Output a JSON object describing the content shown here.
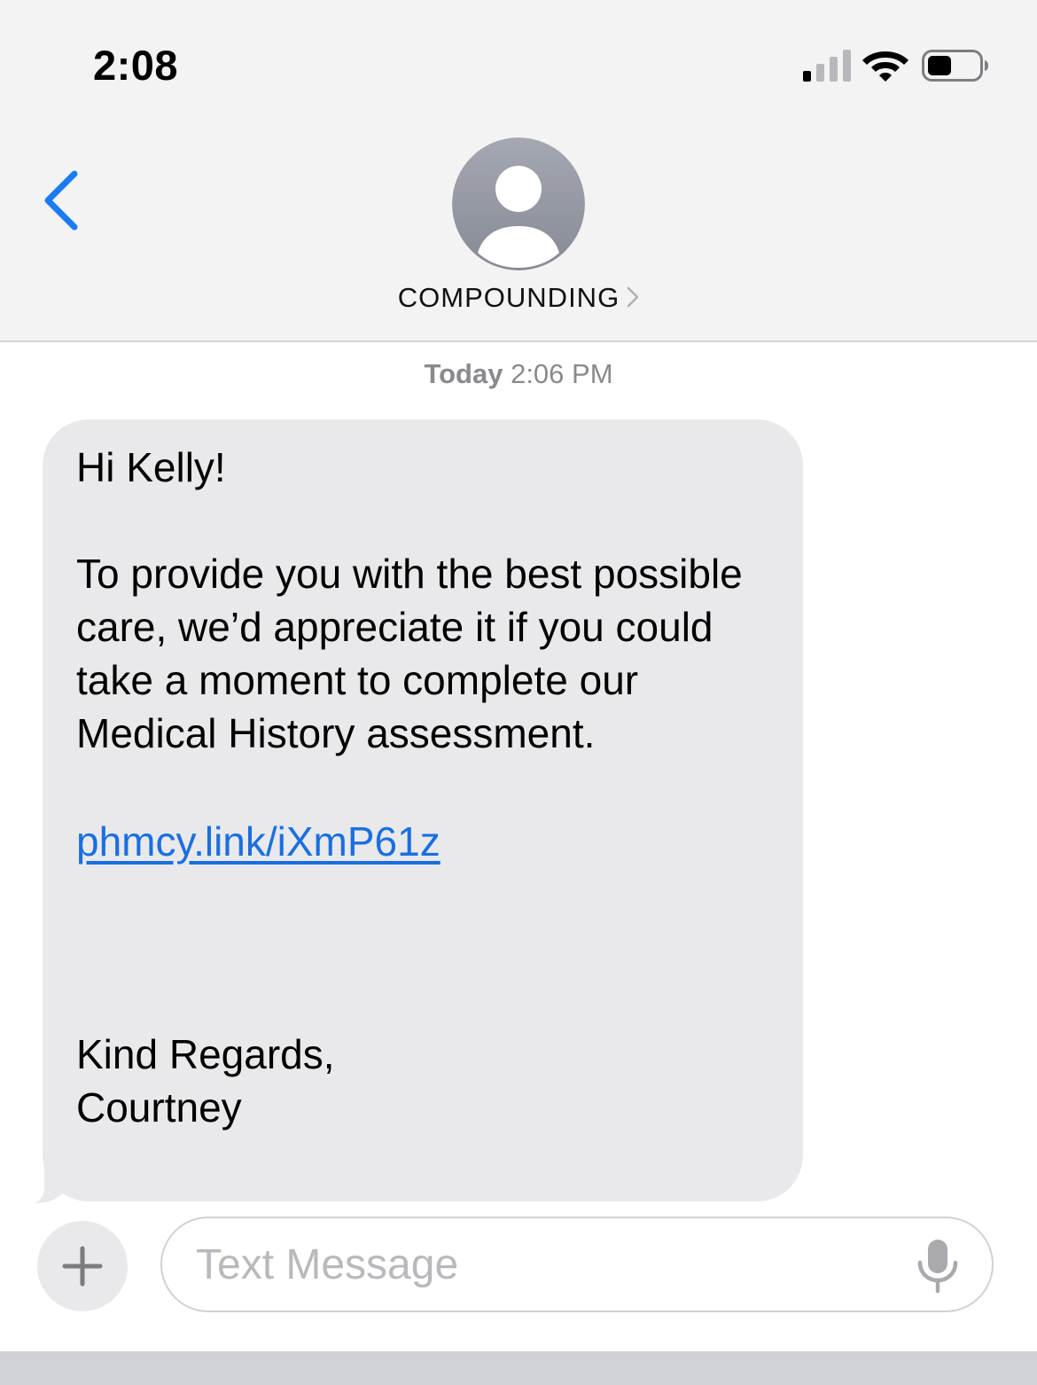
{
  "status_bar": {
    "time": "2:08",
    "signal_icon": "cellular-signal-icon",
    "wifi_icon": "wifi-icon",
    "battery_icon": "battery-icon"
  },
  "header": {
    "back_icon": "chevron-left-icon",
    "avatar_icon": "person-avatar-icon",
    "contact_name": "COMPOUNDING",
    "contact_chevron": "›"
  },
  "conversation": {
    "timestamp_day": "Today",
    "timestamp_time": "2:06 PM",
    "message": {
      "greeting": "Hi Kelly!",
      "body": "To provide you with the best possible care, we’d appreciate it if you could take a moment to complete our Medical History assessment.",
      "link": "phmcy.link/iXmP61z",
      "closing": "Kind Regards,",
      "signature": "Courtney"
    }
  },
  "composer": {
    "plus_label": "+",
    "placeholder": "Text Message",
    "mic_icon": "microphone-icon"
  },
  "colors": {
    "accent": "#1a7cf2",
    "link": "#1a6fe0",
    "bubble": "#e9e9eb",
    "header_bg": "#f3f3f4"
  }
}
